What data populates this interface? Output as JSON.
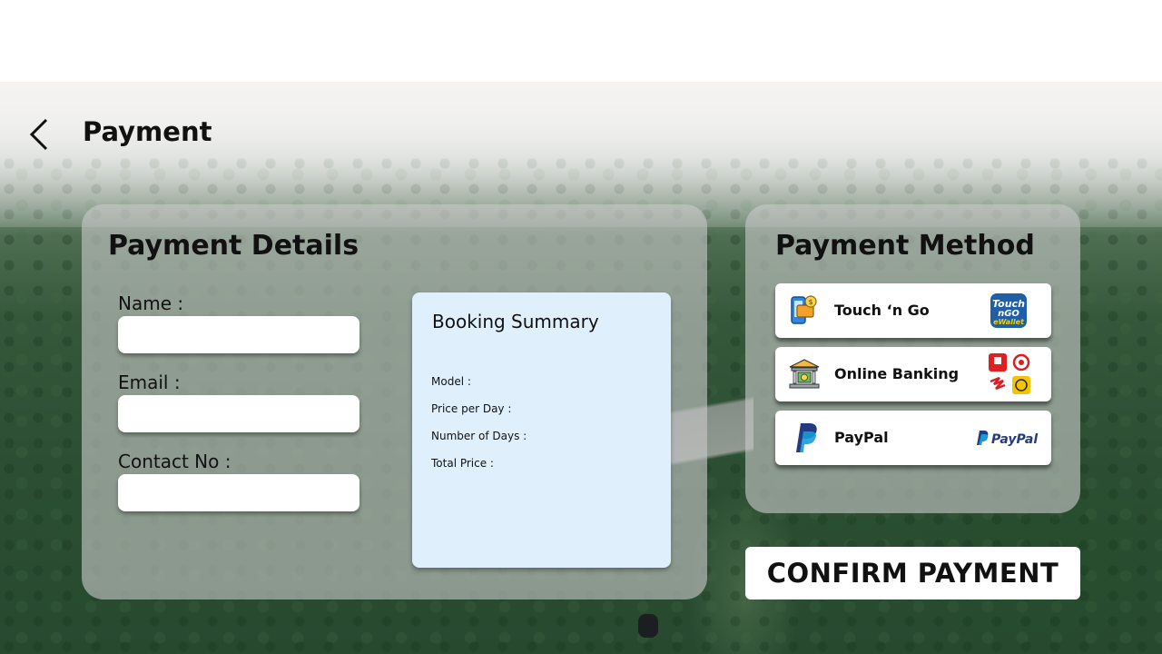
{
  "header": {
    "title": "Payment"
  },
  "details": {
    "title": "Payment Details",
    "fields": [
      {
        "label": "Name :",
        "value": ""
      },
      {
        "label": "Email :",
        "value": ""
      },
      {
        "label": "Contact No :",
        "value": ""
      }
    ]
  },
  "summary": {
    "title": "Booking Summary",
    "rows": [
      "Model :",
      "Price per Day :",
      "Number of Days :",
      "Total Price :"
    ]
  },
  "methods": {
    "title": "Payment Method",
    "options": [
      {
        "label": "Touch ‘n Go",
        "icon": "phone-wallet-icon",
        "logo": "touch-n-go-ewallet-logo",
        "logo_text": "eWallet"
      },
      {
        "label": "Online Banking",
        "icon": "bank-icon",
        "logo": "bank-logos"
      },
      {
        "label": "PayPal",
        "icon": "paypal-icon",
        "logo": "paypal-logo",
        "logo_text": "PayPal"
      }
    ]
  },
  "confirm": {
    "label": "CONFIRM PAYMENT"
  },
  "colors": {
    "summary_bg": "#dff0fc",
    "tng_blue": "#1f5fa8",
    "tng_yellow": "#f5d000",
    "paypal_dark": "#253b80",
    "paypal_light": "#179bd7"
  }
}
